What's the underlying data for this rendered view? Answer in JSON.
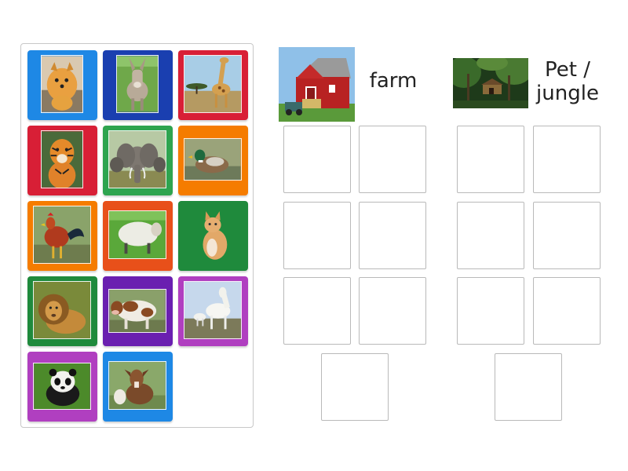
{
  "activity": {
    "categories": [
      {
        "label": "farm",
        "image": "red-barn-photo"
      },
      {
        "label": "Pet / jungle",
        "label_line1": "Pet /",
        "label_line2": "jungle",
        "image": "jungle-treehouse-photo"
      }
    ],
    "cards": [
      {
        "animal": "pomeranian-dog",
        "frame_color": "#1e88e5"
      },
      {
        "animal": "donkey",
        "frame_color": "#1a3fb0"
      },
      {
        "animal": "giraffe",
        "frame_color": "#d81f36"
      },
      {
        "animal": "tiger",
        "frame_color": "#d81f36"
      },
      {
        "animal": "elephant",
        "frame_color": "#2ea44f"
      },
      {
        "animal": "duck",
        "frame_color": "#f57c00"
      },
      {
        "animal": "rooster",
        "frame_color": "#f57c00"
      },
      {
        "animal": "sheep",
        "frame_color": "#e8501a"
      },
      {
        "animal": "cat",
        "frame_color": "#1f8a3c"
      },
      {
        "animal": "lion",
        "frame_color": "#1f8a3c"
      },
      {
        "animal": "cow",
        "frame_color": "#6a1fb0"
      },
      {
        "animal": "horse",
        "frame_color": "#b03fc0"
      },
      {
        "animal": "panda",
        "frame_color": "#b03fc0"
      },
      {
        "animal": "goat",
        "frame_color": "#1e88e5"
      }
    ]
  }
}
